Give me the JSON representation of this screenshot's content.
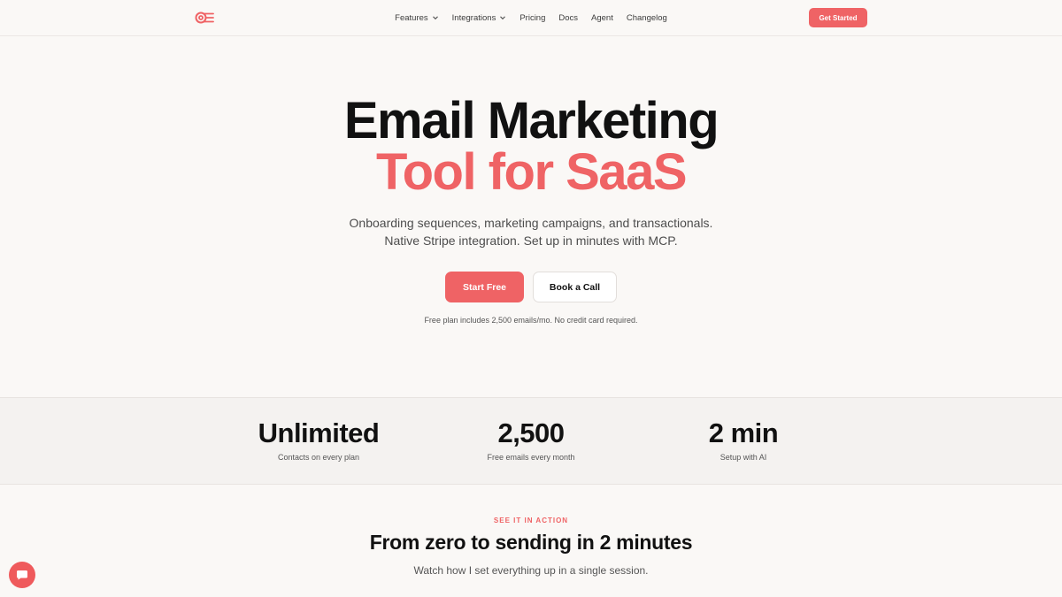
{
  "colors": {
    "accent": "#ef6365",
    "text": "#111111",
    "muted": "#555555",
    "background": "#faf8f6"
  },
  "header": {
    "logo_icon": "envelope-at-logo",
    "nav": [
      {
        "label": "Features",
        "has_dropdown": true
      },
      {
        "label": "Integrations",
        "has_dropdown": true
      },
      {
        "label": "Pricing",
        "has_dropdown": false
      },
      {
        "label": "Docs",
        "has_dropdown": false
      },
      {
        "label": "Agent",
        "has_dropdown": false
      },
      {
        "label": "Changelog",
        "has_dropdown": false
      }
    ],
    "cta_label": "Get Started"
  },
  "hero": {
    "title_line1": "Email Marketing",
    "title_line2": "Tool for SaaS",
    "subtitle_line1": "Onboarding sequences, marketing campaigns, and transactionals.",
    "subtitle_line2": "Native Stripe integration. Set up in minutes with MCP.",
    "primary_button": "Start Free",
    "secondary_button": "Book a Call",
    "fine_print": "Free plan includes 2,500 emails/mo. No credit card required."
  },
  "stats": [
    {
      "value": "Unlimited",
      "label": "Contacts on every plan"
    },
    {
      "value": "2,500",
      "label": "Free emails every month"
    },
    {
      "value": "2 min",
      "label": "Setup with AI"
    }
  ],
  "section": {
    "eyebrow": "SEE IT IN ACTION",
    "title": "From zero to sending in 2 minutes",
    "subtitle": "Watch how I set everything up in a single session."
  },
  "chat": {
    "icon": "chat-icon"
  }
}
